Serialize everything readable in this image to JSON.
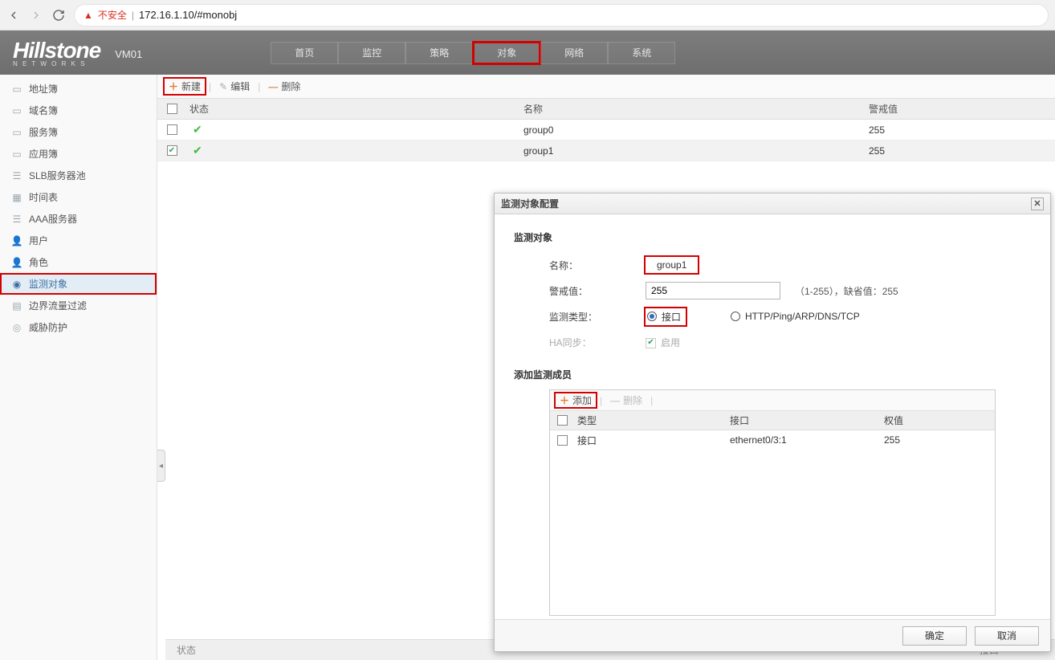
{
  "browser": {
    "insecure_label": "不安全",
    "url": "172.16.1.10/#monobj"
  },
  "header": {
    "logo_main": "Hillstone",
    "logo_sub": "N E T W O R K S",
    "vm": "VM01",
    "tabs": [
      "首页",
      "监控",
      "策略",
      "对象",
      "网络",
      "系统"
    ]
  },
  "sidebar": {
    "items": [
      {
        "label": "地址簿"
      },
      {
        "label": "域名簿"
      },
      {
        "label": "服务簿"
      },
      {
        "label": "应用簿"
      },
      {
        "label": "SLB服务器池"
      },
      {
        "label": "时间表"
      },
      {
        "label": "AAA服务器"
      },
      {
        "label": "用户"
      },
      {
        "label": "角色"
      },
      {
        "label": "监测对象",
        "active": true
      },
      {
        "label": "边界流量过滤"
      },
      {
        "label": "威胁防护"
      }
    ]
  },
  "toolbar": {
    "new_label": "新建",
    "edit_label": "编辑",
    "del_label": "删除"
  },
  "grid": {
    "head_status": "状态",
    "head_name": "名称",
    "head_warn": "警戒值",
    "rows": [
      {
        "checked": false,
        "status": "ok",
        "name": "group0",
        "warn": "255"
      },
      {
        "checked": true,
        "status": "ok",
        "name": "group1",
        "warn": "255"
      }
    ]
  },
  "bottom": {
    "c1": "状态",
    "c2": "接口"
  },
  "dialog": {
    "title": "监测对象配置",
    "section1": "监测对象",
    "name_label": "名称：",
    "name_value": "group1",
    "warn_label": "警戒值：",
    "warn_value": "255",
    "warn_hint": "（1-255），缺省值：255",
    "type_label": "监测类型：",
    "type_opt1": "接口",
    "type_opt2": "HTTP/Ping/ARP/DNS/TCP",
    "ha_label": "HA同步：",
    "ha_checkbox_label": "启用",
    "section2": "添加监测成员",
    "member_add": "添加",
    "member_del": "删除",
    "mhead_type": "类型",
    "mhead_iface": "接口",
    "mhead_weight": "权值",
    "members": [
      {
        "type": "接口",
        "iface": "ethernet0/3:1",
        "weight": "255"
      }
    ],
    "ok": "确定",
    "cancel": "取消"
  }
}
